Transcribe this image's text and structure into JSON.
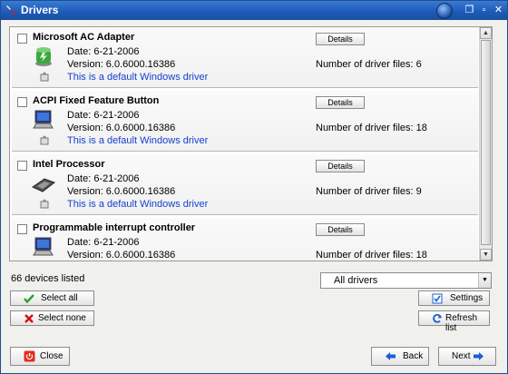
{
  "window": {
    "title": "Drivers"
  },
  "devices": [
    {
      "name": "Microsoft AC Adapter",
      "date": "Date: 6-21-2006",
      "version": "Version: 6.0.6000.16386",
      "note": "This is a default Windows driver",
      "details": "Details",
      "files": "Number of driver files: 6",
      "icon": "battery-icon"
    },
    {
      "name": "ACPI Fixed Feature Button",
      "date": "Date: 6-21-2006",
      "version": "Version: 6.0.6000.16386",
      "note": "This is a default Windows driver",
      "details": "Details",
      "files": "Number of driver files: 18",
      "icon": "computer-icon"
    },
    {
      "name": "Intel Processor",
      "date": "Date: 6-21-2006",
      "version": "Version: 6.0.6000.16386",
      "note": "This is a default Windows driver",
      "details": "Details",
      "files": "Number of driver files: 9",
      "icon": "processor-icon"
    },
    {
      "name": "Programmable interrupt controller",
      "date": "Date: 6-21-2006",
      "version": "Version: 6.0.6000.16386",
      "details": "Details",
      "files": "Number of driver files: 18",
      "icon": "computer-icon"
    }
  ],
  "footer": {
    "count": "66 devices listed",
    "filter": "All drivers",
    "select_all": "Select all",
    "select_none": "Select none",
    "settings": "Settings",
    "refresh": "Refresh list",
    "close": "Close",
    "back": "Back",
    "next": "Next"
  },
  "colors": {
    "title_bar": "#1d5cb8",
    "link_text": "#1540d0",
    "select_all_check": "#2ea02e",
    "select_none_x": "#d01010",
    "arrow_blue": "#1a5fd0"
  }
}
